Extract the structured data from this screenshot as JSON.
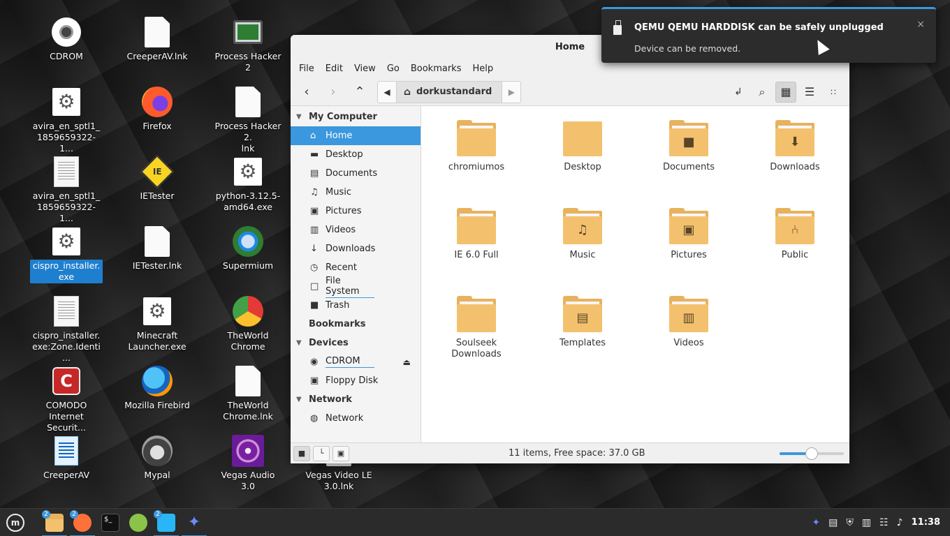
{
  "desktop": {
    "icons": [
      {
        "label": "CDROM",
        "icon": "cdrom-icon"
      },
      {
        "label": "CreeperAV.lnk",
        "icon": "document-icon"
      },
      {
        "label": "Process Hacker 2",
        "icon": "process-hacker-icon"
      },
      {
        "label": "avira_en_sptl1_\n1859659322-1...",
        "icon": "gear-icon"
      },
      {
        "label": "Firefox",
        "icon": "firefox-icon"
      },
      {
        "label": "Process Hacker 2.\nlnk",
        "icon": "document-icon"
      },
      {
        "label": "avira_en_sptl1_\n1859659322-1...",
        "icon": "text-document-icon"
      },
      {
        "label": "IETester",
        "icon": "ietester-icon"
      },
      {
        "label": "python-3.12.5-\namd64.exe",
        "icon": "gear-icon"
      },
      {
        "label": "cispro_installer.\nexe",
        "icon": "gear-icon"
      },
      {
        "label": "IETester.lnk",
        "icon": "document-icon"
      },
      {
        "label": "Supermium",
        "icon": "supermium-icon"
      },
      {
        "label": "cispro_installer.\nexe:Zone.Identi...",
        "icon": "text-document-icon"
      },
      {
        "label": "Minecraft\nLauncher.exe",
        "icon": "gear-icon"
      },
      {
        "label": "TheWorld Chrome",
        "icon": "theworld-chrome-icon"
      },
      {
        "label": "COMODO\nInternet Securit...",
        "icon": "comodo-icon"
      },
      {
        "label": "Mozilla Firebird",
        "icon": "firebird-icon"
      },
      {
        "label": "TheWorld\nChrome.lnk",
        "icon": "document-icon"
      },
      {
        "label": "CreeperAV",
        "icon": "creeperav-icon"
      },
      {
        "label": "Mypal",
        "icon": "mypal-icon"
      },
      {
        "label": "Vegas Audio 3.0",
        "icon": "vegas-audio-icon"
      },
      {
        "label": "Vegas Video LE\n3.0.lnk",
        "icon": "document-icon"
      }
    ]
  },
  "file_manager": {
    "title": "Home",
    "menu": [
      "File",
      "Edit",
      "View",
      "Go",
      "Bookmarks",
      "Help"
    ],
    "path": "dorkustandard",
    "sidebar": {
      "my_computer": "My Computer",
      "places": [
        "Home",
        "Desktop",
        "Documents",
        "Music",
        "Pictures",
        "Videos",
        "Downloads",
        "Recent",
        "File System",
        "Trash"
      ],
      "bookmarks": "Bookmarks",
      "devices": "Devices",
      "device_items": [
        "CDROM",
        "Floppy Disk"
      ],
      "network": "Network",
      "network_items": [
        "Network"
      ]
    },
    "items": [
      {
        "name": "chromiumos",
        "emblem": ""
      },
      {
        "name": "Desktop",
        "emblem": ""
      },
      {
        "name": "Documents",
        "emblem": "document-emblem-icon"
      },
      {
        "name": "Downloads",
        "emblem": "download-arrow-icon"
      },
      {
        "name": "IE 6.0 Full",
        "emblem": ""
      },
      {
        "name": "Music",
        "emblem": "music-note-icon"
      },
      {
        "name": "Pictures",
        "emblem": "camera-icon"
      },
      {
        "name": "Public",
        "emblem": "share-icon"
      },
      {
        "name": "Soulseek\nDownloads",
        "emblem": ""
      },
      {
        "name": "Templates",
        "emblem": "template-emblem-icon"
      },
      {
        "name": "Videos",
        "emblem": "film-icon"
      }
    ],
    "status": "11 items, Free space: 37.0 GB",
    "zoom_level": 0.5
  },
  "notification": {
    "title": "QEMU QEMU HARDDISK can be safely unplugged",
    "body": "Device can be removed.",
    "close": "×"
  },
  "taskbar": {
    "menu_label": "m",
    "apps": [
      {
        "name": "files",
        "badge": "2",
        "running": true
      },
      {
        "name": "firefox",
        "badge": "2",
        "running": true
      },
      {
        "name": "terminal",
        "badge": "",
        "running": false
      },
      {
        "name": "calculator",
        "badge": "",
        "running": false
      },
      {
        "name": "dolphin",
        "badge": "2",
        "running": true
      },
      {
        "name": "firebird",
        "badge": "",
        "running": true
      }
    ],
    "clock": "11:38"
  },
  "colors": {
    "accent": "#3b98de",
    "folder": "#f3c16e",
    "folder_dark": "#e8b25c"
  }
}
